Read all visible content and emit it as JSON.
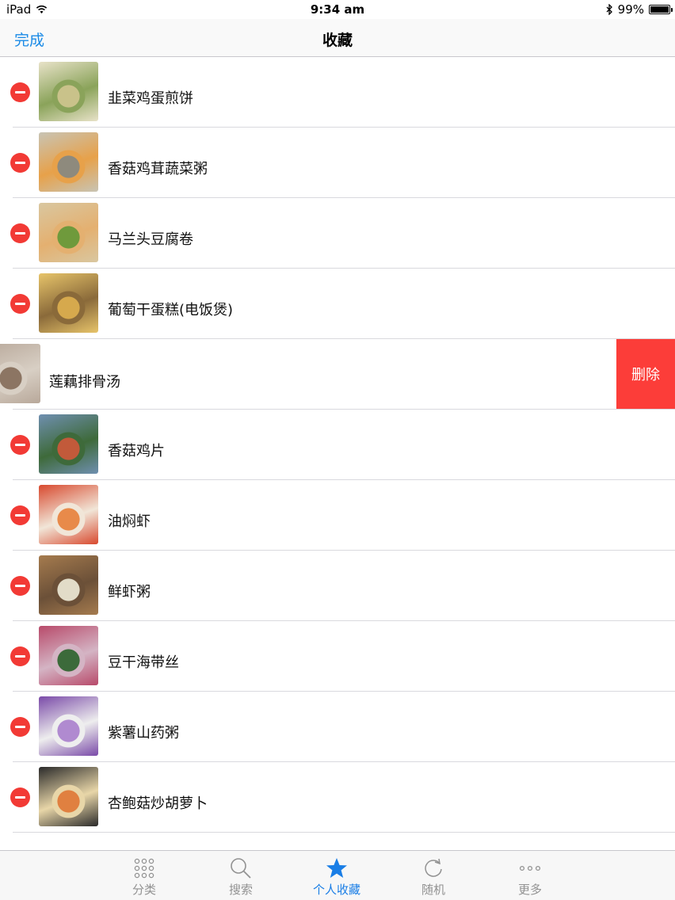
{
  "status": {
    "device": "iPad",
    "time": "9:34 am",
    "battery": "99%",
    "battery_level": 0.99
  },
  "nav": {
    "done_label": "完成",
    "title": "收藏"
  },
  "favorites": [
    {
      "name": "韭菜鸡蛋煎饼",
      "thumb_colors": [
        "#e8e2c8",
        "#c9c28a",
        "#8aa35a"
      ]
    },
    {
      "name": "香菇鸡茸蔬菜粥",
      "thumb_colors": [
        "#c8c4b4",
        "#8e8a7d",
        "#e7a14a"
      ]
    },
    {
      "name": "马兰头豆腐卷",
      "thumb_colors": [
        "#d9c7a0",
        "#6f9a3c",
        "#e4b070"
      ]
    },
    {
      "name": "葡萄干蛋糕(电饭煲)",
      "thumb_colors": [
        "#e7c46a",
        "#d6a94d",
        "#8a6a3a"
      ]
    },
    {
      "name": "莲藕排骨汤",
      "thumb_colors": [
        "#b8a89a",
        "#8c7563",
        "#d8cfc4"
      ]
    },
    {
      "name": "香菇鸡片",
      "thumb_colors": [
        "#6f8fb0",
        "#c25a3a",
        "#3e6a3a"
      ]
    },
    {
      "name": "油焖虾",
      "thumb_colors": [
        "#d8492e",
        "#e88a4a",
        "#f1e6d8"
      ]
    },
    {
      "name": "鲜虾粥",
      "thumb_colors": [
        "#a57b4e",
        "#e2dcc8",
        "#6b5038"
      ]
    },
    {
      "name": "豆干海带丝",
      "thumb_colors": [
        "#b84a6a",
        "#3c6a3a",
        "#d4b4c4"
      ]
    },
    {
      "name": "紫薯山药粥",
      "thumb_colors": [
        "#7a4aa8",
        "#b08ad0",
        "#eeeeee"
      ]
    },
    {
      "name": "杏鲍菇炒胡萝卜",
      "thumb_colors": [
        "#2a2a2a",
        "#e08040",
        "#e8d6a8"
      ]
    }
  ],
  "swiped_index": 4,
  "delete_action_label": "删除",
  "tabs": [
    {
      "label": "分类",
      "icon": "grid-dots-icon",
      "active": false
    },
    {
      "label": "搜索",
      "icon": "search-icon",
      "active": false
    },
    {
      "label": "个人收藏",
      "icon": "star-icon",
      "active": true
    },
    {
      "label": "随机",
      "icon": "refresh-icon",
      "active": false
    },
    {
      "label": "更多",
      "icon": "more-dots-icon",
      "active": false
    }
  ],
  "colors": {
    "accent": "#1a7ee6",
    "delete_red": "#fc3d39",
    "delete_circle": "#f23a35"
  }
}
